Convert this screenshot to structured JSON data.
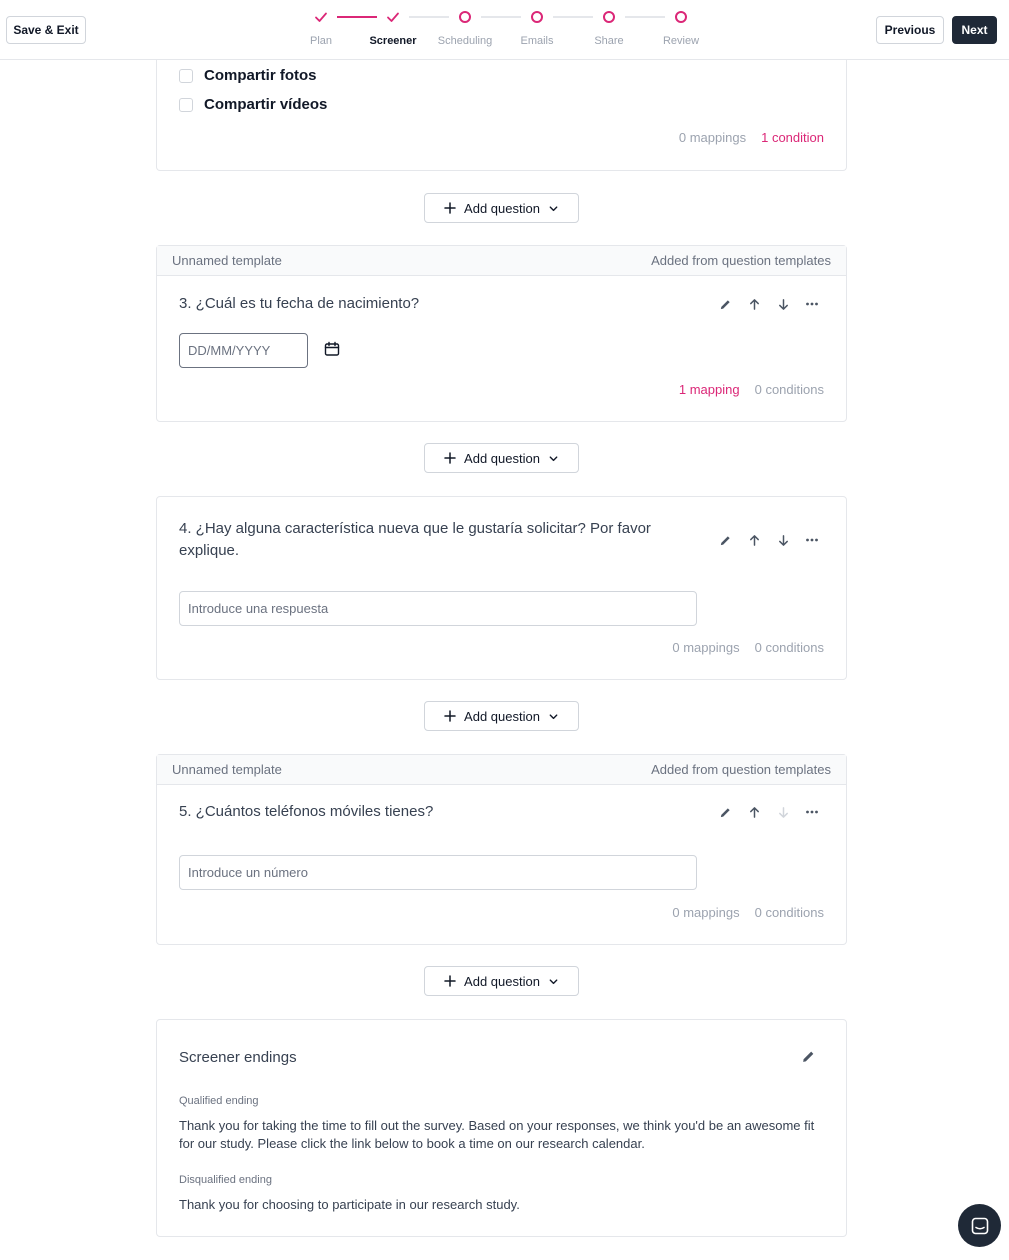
{
  "header": {
    "save_exit": "Save & Exit",
    "previous": "Previous",
    "next": "Next",
    "steps": [
      {
        "label": "Plan",
        "state": "done"
      },
      {
        "label": "Screener",
        "state": "active"
      },
      {
        "label": "Scheduling",
        "state": "pending"
      },
      {
        "label": "Emails",
        "state": "pending"
      },
      {
        "label": "Share",
        "state": "pending"
      },
      {
        "label": "Review",
        "state": "pending"
      }
    ]
  },
  "colors": {
    "accent": "#db2777",
    "dark": "#1f2937",
    "muted": "#9ca3af"
  },
  "question2_partial": {
    "options": [
      "Compartir fotos",
      "Compartir vídeos"
    ],
    "mappings": "0 mappings",
    "conditions": "1 condition"
  },
  "add_question_label": "Add question",
  "questions": [
    {
      "band_left": "Unnamed template",
      "band_right": "Added from question templates",
      "title": "3. ¿Cuál es tu fecha de nacimiento?",
      "placeholder": "DD/MM/YYYY",
      "mappings": "1 mapping",
      "conditions": "0 conditions"
    },
    {
      "title": "4. ¿Hay alguna característica nueva que le gustaría solicitar? Por favor explique.",
      "placeholder": "Introduce una respuesta",
      "mappings": "0 mappings",
      "conditions": "0 conditions"
    },
    {
      "band_left": "Unnamed template",
      "band_right": "Added from question templates",
      "title": "5. ¿Cuántos teléfonos móviles tienes?",
      "placeholder": "Introduce un número",
      "mappings": "0 mappings",
      "conditions": "0 conditions"
    }
  ],
  "endings": {
    "title": "Screener endings",
    "qualified_label": "Qualified ending",
    "qualified_text": "Thank you for taking the time to fill out the survey. Based on your responses, we think you'd be an awesome fit for our study. Please click the link below to book a time on our research calendar.",
    "disqualified_label": "Disqualified ending",
    "disqualified_text": "Thank you for choosing to participate in our research study."
  },
  "icons": [
    "check-icon",
    "calendar-icon",
    "pencil-icon",
    "arrow-up-icon",
    "arrow-down-icon",
    "more-icon",
    "plus-icon",
    "chevron-down-icon",
    "chat-icon"
  ]
}
